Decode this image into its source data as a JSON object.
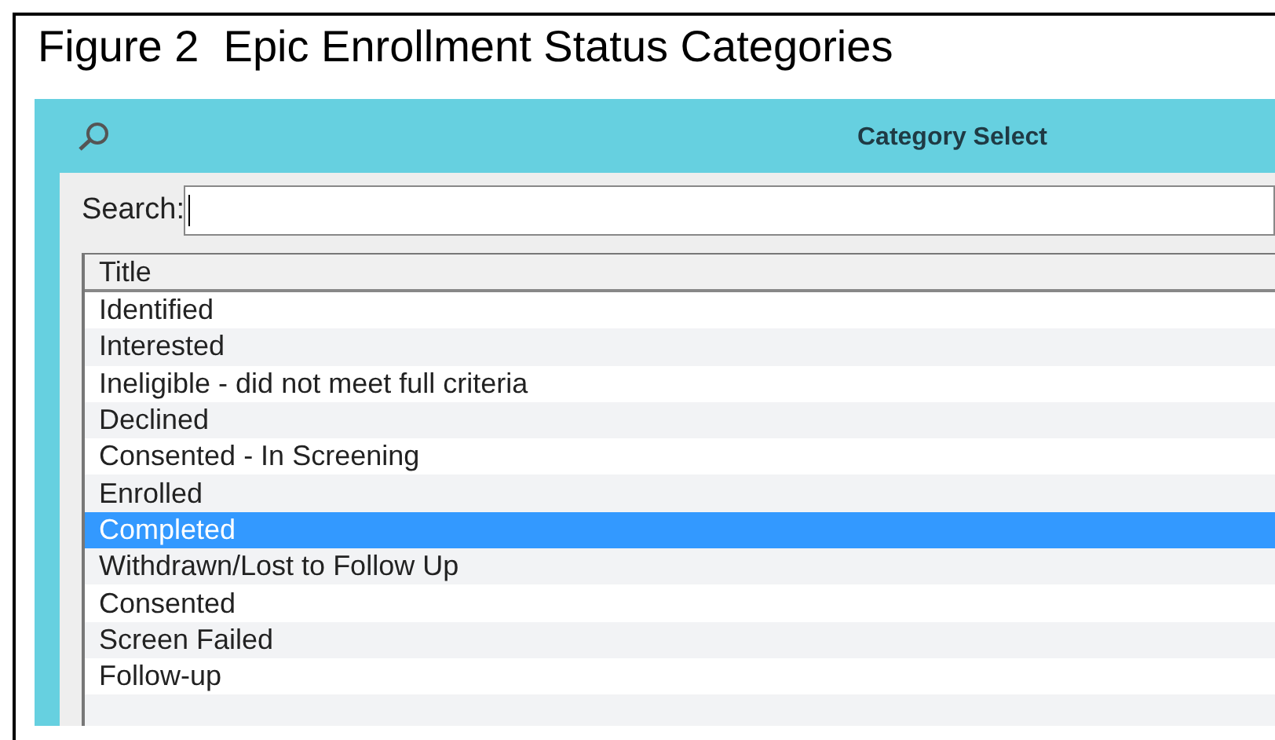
{
  "figure_caption": "Figure 2  Epic Enrollment Status Categories",
  "window": {
    "title": "Category Select"
  },
  "search": {
    "label": "Search:"
  },
  "table": {
    "columns": [
      "Title"
    ],
    "rows": [
      {
        "title": "Identified",
        "selected": false
      },
      {
        "title": "Interested",
        "selected": false
      },
      {
        "title": "Ineligible - did not meet full criteria",
        "selected": false
      },
      {
        "title": "Declined",
        "selected": false
      },
      {
        "title": "Consented - In Screening",
        "selected": false
      },
      {
        "title": "Enrolled",
        "selected": false
      },
      {
        "title": "Completed",
        "selected": true
      },
      {
        "title": "Withdrawn/Lost to Follow Up",
        "selected": false
      },
      {
        "title": "Consented",
        "selected": false
      },
      {
        "title": "Screen Failed",
        "selected": false
      },
      {
        "title": "Follow-up",
        "selected": false
      }
    ]
  }
}
